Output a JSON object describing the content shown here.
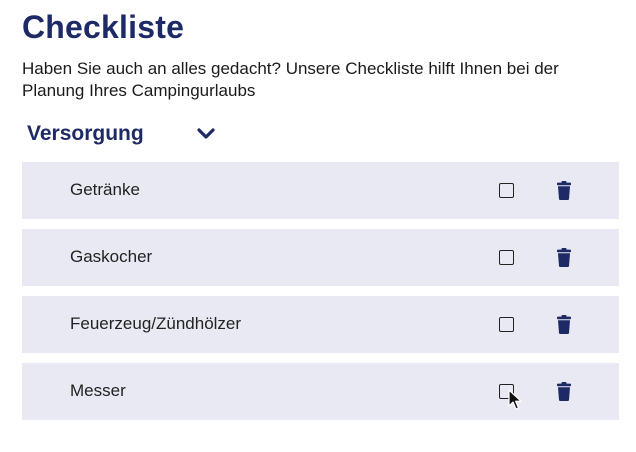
{
  "page": {
    "title": "Checkliste",
    "subtitle": "Haben Sie auch an alles gedacht? Unsere Checkliste hilft Ihnen bei der Planung Ihres Campingurlaubs"
  },
  "section": {
    "title": "Versorgung",
    "expanded": true,
    "toggle_icon": "chevron-down-icon"
  },
  "items": [
    {
      "label": "Getränke",
      "checked": false
    },
    {
      "label": "Gaskocher",
      "checked": false
    },
    {
      "label": "Feuerzeug/Zündhölzer",
      "checked": false
    },
    {
      "label": "Messer",
      "checked": false
    }
  ],
  "icons": {
    "checkbox": "checkbox-icon",
    "delete": "trash-icon",
    "pointer": "mouse-pointer-icon"
  },
  "colors": {
    "accent": "#1e2a66",
    "row_background": "#e8e9f3",
    "text": "#222222"
  }
}
